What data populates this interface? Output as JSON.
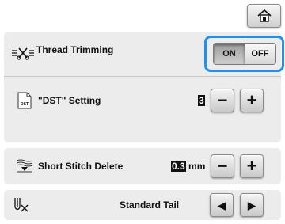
{
  "header": {
    "home_icon": "home-icon"
  },
  "settings": {
    "thread_trimming": {
      "label": "Thread Trimming",
      "icon": "thread-trim-icon",
      "on_label": "ON",
      "off_label": "OFF",
      "selected": "ON",
      "highlight_color": "#1e90f0"
    },
    "dst_setting": {
      "label": "\"DST\" Setting",
      "icon": "dst-file-icon",
      "icon_text": "DST",
      "value": "3",
      "minus": "−",
      "plus": "+"
    },
    "short_stitch_delete": {
      "label": "Short Stitch Delete",
      "icon": "short-stitch-icon",
      "value": "0.3",
      "unit": "mm",
      "minus": "−",
      "plus": "+"
    },
    "tail": {
      "icon": "thread-tail-icon",
      "value": "Standard Tail",
      "left_arrow": "◀",
      "right_arrow": "▶"
    }
  }
}
